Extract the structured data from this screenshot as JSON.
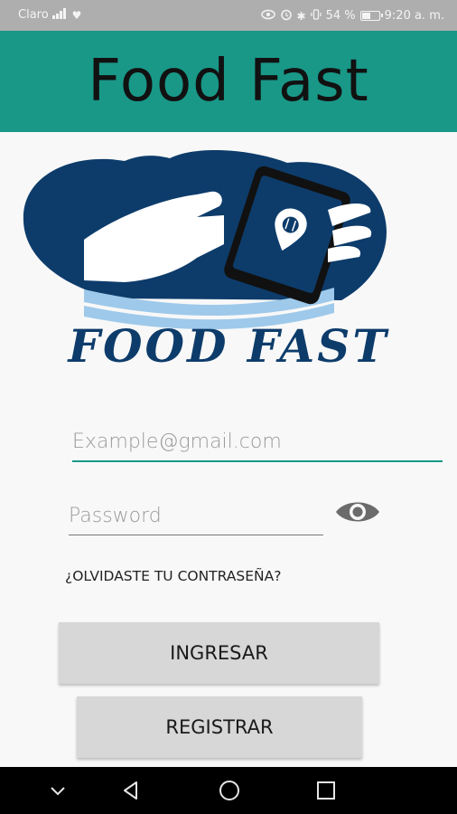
{
  "status_bar": {
    "carrier": "Claro",
    "battery": "54 %",
    "battery_level": 0.54,
    "time": "9:20 a. m."
  },
  "app_bar": {
    "title": "Food Fast"
  },
  "logo": {
    "text": "FOOD FAST",
    "colors": {
      "dark": "#0d3c6b",
      "light": "#9ec9ea"
    }
  },
  "login": {
    "email_placeholder": "Example@gmail.com",
    "password_placeholder": "Password",
    "forgot_password": "¿OLVIDASTE TU CONTRASEÑA?",
    "login_button": "INGRESAR",
    "register_button": "REGISTRAR"
  },
  "colors": {
    "accent": "#199888",
    "status_bar": "#aeaeae",
    "button": "#d6d7d6"
  },
  "nav_bar": {
    "icons": [
      "chevron-down-icon",
      "back-icon",
      "home-icon",
      "recents-icon"
    ]
  }
}
